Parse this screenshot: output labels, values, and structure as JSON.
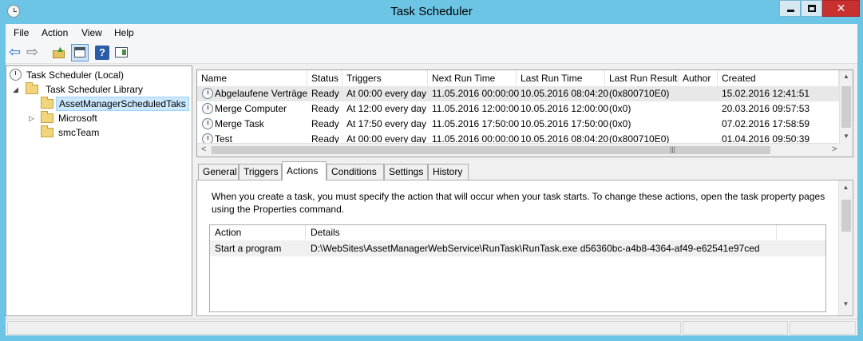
{
  "window": {
    "title": "Task Scheduler",
    "close_glyph": "✕"
  },
  "menu": {
    "file": "File",
    "action": "Action",
    "view": "View",
    "help": "Help"
  },
  "toolbar": {
    "icons": [
      "back-arrow-icon",
      "forward-arrow-icon",
      "up-folder-icon",
      "show-hide-console-tree-icon",
      "help-icon",
      "show-hide-action-pane-icon"
    ],
    "back_glyph": "⇦",
    "forward_glyph": "⇨",
    "up_glyph": "▲",
    "help_glyph": "?"
  },
  "tree": {
    "root": "Task Scheduler (Local)",
    "library": "Task Scheduler Library",
    "children": [
      "AssetManagerScheduledTaks",
      "Microsoft",
      "smcTeam"
    ],
    "selected": "AssetManagerScheduledTaks",
    "expanded_glyph": "◢",
    "collapsed_glyph": "▷"
  },
  "tasks": {
    "columns": [
      "Name",
      "Status",
      "Triggers",
      "Next Run Time",
      "Last Run Time",
      "Last Run Result",
      "Author",
      "Created"
    ],
    "rows": [
      {
        "name": "Abgelaufene Verträge",
        "status": "Ready",
        "triggers": "At 00:00 every day",
        "next": "11.05.2016 00:00:00",
        "last": "10.05.2016 08:04:20",
        "result": "(0x800710E0)",
        "author": "",
        "created": "15.02.2016 12:41:51"
      },
      {
        "name": "Merge Computer",
        "status": "Ready",
        "triggers": "At 12:00 every day",
        "next": "11.05.2016 12:00:00",
        "last": "10.05.2016 12:00:00",
        "result": "(0x0)",
        "author": "",
        "created": "20.03.2016 09:57:53"
      },
      {
        "name": "Merge Task",
        "status": "Ready",
        "triggers": "At 17:50 every day",
        "next": "11.05.2016 17:50:00",
        "last": "10.05.2016 17:50:00",
        "result": "(0x0)",
        "author": "",
        "created": "07.02.2016 17:58:59"
      },
      {
        "name": "Test",
        "status": "Ready",
        "triggers": "At 00:00 every day",
        "next": "11.05.2016 00:00:00",
        "last": "10.05.2016 08:04:20",
        "result": "(0x800710E0)",
        "author": "",
        "created": "01.04.2016 09:50:39"
      }
    ],
    "scroll_up": "▲",
    "scroll_down": "▼",
    "scroll_left": "<",
    "scroll_right": ">",
    "grip": "|||"
  },
  "tabs": [
    "General",
    "Triggers",
    "Actions",
    "Conditions",
    "Settings",
    "History"
  ],
  "active_tab": "Actions",
  "actions_panel": {
    "description": "When you create a task, you must specify the action that will occur when your task starts.  To change these actions, open the task property pages using the Properties command.",
    "columns": [
      "Action",
      "Details"
    ],
    "rows": [
      {
        "action": "Start a program",
        "details": "D:\\WebSites\\AssetManagerWebService\\RunTask\\RunTask.exe d56360bc-a4b8-4364-af49-e62541e97ced"
      }
    ]
  },
  "colors": {
    "titlebar": "#6dc5e5",
    "close": "#c7302f",
    "selection": "#cce8ff"
  }
}
